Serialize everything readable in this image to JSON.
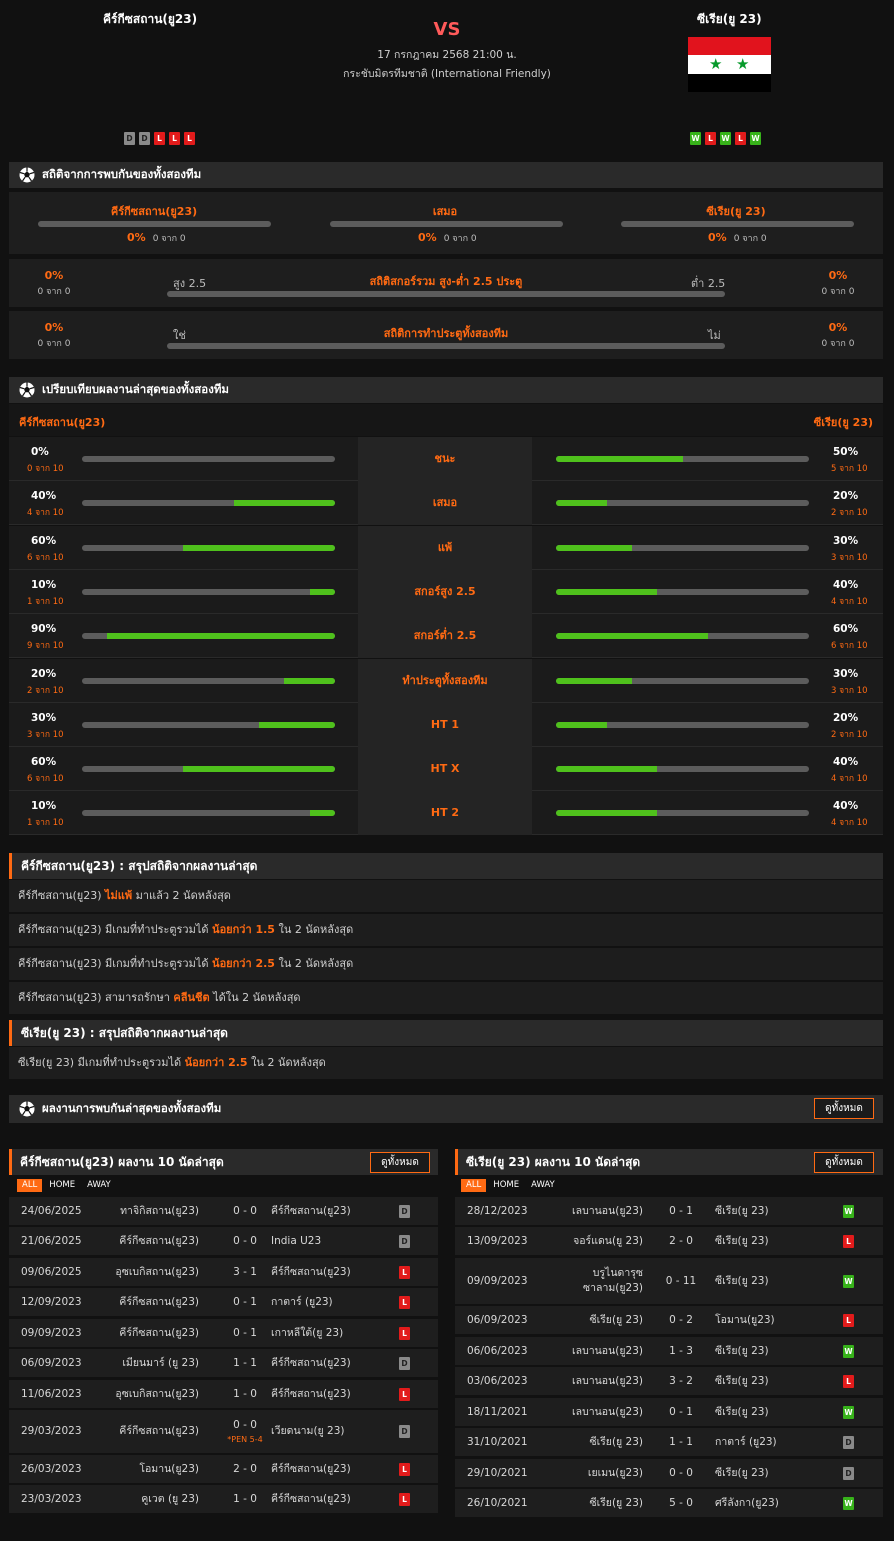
{
  "match": {
    "home": "คีร์กีซสถาน(ยู23)",
    "away": "ซีเรีย(ยู 23)",
    "vs": "VS",
    "date": "17 กรกฎาคม 2568 21:00 น.",
    "competition": "กระชับมิตรทีมชาติ (International Friendly)",
    "home_form": [
      "D",
      "D",
      "L",
      "L",
      "L"
    ],
    "away_form": [
      "W",
      "L",
      "W",
      "L",
      "W"
    ]
  },
  "h2h": {
    "title": "สถิติจากการพบกันของทั้งสองทีม",
    "home": "คีร์กีซสถาน(ยู23)",
    "draw": "เสมอ",
    "away": "ซีเรีย(ยู 23)",
    "home_pct": "0%",
    "draw_pct": "0%",
    "away_pct": "0%",
    "home_sub": "0 จาก 0",
    "draw_sub": "0 จาก 0",
    "away_sub": "0 จาก 0",
    "ou_title": "สถิติสกอร์รวม สูง-ต่ำ 2.5 ประตู",
    "over": "สูง 2.5",
    "under": "ต่ำ 2.5",
    "ou_left_pct": "0%",
    "ou_left_sub": "0 จาก 0",
    "ou_right_pct": "0%",
    "ou_right_sub": "0 จาก 0",
    "btts_title": "สถิติการทำประตูทั้งสองทีม",
    "yes": "ใช่",
    "no": "ไม่",
    "btts_left_pct": "0%",
    "btts_left_sub": "0 จาก 0",
    "btts_right_pct": "0%",
    "btts_right_sub": "0 จาก 0"
  },
  "compare": {
    "title": "เปรียบเทียบผลงานล่าสุดของทั้งสองทีม",
    "home": "คีร์กีซสถาน(ยู23)",
    "away": "ซีเรีย(ยู 23)",
    "rows": [
      {
        "label": "ชนะ",
        "hp": "0%",
        "hs": "0 จาก 10",
        "hv": 0,
        "ap": "50%",
        "as": "5 จาก 10",
        "av": 0.5
      },
      {
        "label": "เสมอ",
        "hp": "40%",
        "hs": "4 จาก 10",
        "hv": 0.4,
        "ap": "20%",
        "as": "2 จาก 10",
        "av": 0.2
      },
      {
        "label": "แพ้",
        "hp": "60%",
        "hs": "6 จาก 10",
        "hv": 0.6,
        "ap": "30%",
        "as": "3 จาก 10",
        "av": 0.3
      },
      {
        "label": "สกอร์สูง 2.5",
        "hp": "10%",
        "hs": "1 จาก 10",
        "hv": 0.1,
        "ap": "40%",
        "as": "4 จาก 10",
        "av": 0.4
      },
      {
        "label": "สกอร์ต่ำ 2.5",
        "hp": "90%",
        "hs": "9 จาก 10",
        "hv": 0.9,
        "ap": "60%",
        "as": "6 จาก 10",
        "av": 0.6
      },
      {
        "label": "ทำประตูทั้งสองทีม",
        "hp": "20%",
        "hs": "2 จาก 10",
        "hv": 0.2,
        "ap": "30%",
        "as": "3 จาก 10",
        "av": 0.3
      },
      {
        "label": "HT 1",
        "hp": "30%",
        "hs": "3 จาก 10",
        "hv": 0.3,
        "ap": "20%",
        "as": "2 จาก 10",
        "av": 0.2
      },
      {
        "label": "HT X",
        "hp": "60%",
        "hs": "6 จาก 10",
        "hv": 0.6,
        "ap": "40%",
        "as": "4 จาก 10",
        "av": 0.4
      },
      {
        "label": "HT 2",
        "hp": "10%",
        "hs": "1 จาก 10",
        "hv": 0.1,
        "ap": "40%",
        "as": "4 จาก 10",
        "av": 0.4
      }
    ]
  },
  "summary_home": {
    "title": "คีร์กีซสถาน(ยู23) : สรุปสถิติจากผลงานล่าสุด",
    "rows": [
      {
        "pre": "คีร์กีซสถาน(ยู23)",
        "hl": "ไม่แพ้",
        "post": "มาแล้ว 2 นัดหลังสุด"
      },
      {
        "pre": "คีร์กีซสถาน(ยู23) มีเกมที่ทำประตูรวมได้",
        "hl": "น้อยกว่า 1.5",
        "post": "ใน 2 นัดหลังสุด"
      },
      {
        "pre": "คีร์กีซสถาน(ยู23) มีเกมที่ทำประตูรวมได้",
        "hl": "น้อยกว่า 2.5",
        "post": "ใน 2 นัดหลังสุด"
      },
      {
        "pre": "คีร์กีซสถาน(ยู23) สามารถรักษา",
        "hl": "คลีนชีต",
        "post": "ได้ใน 2 นัดหลังสุด"
      }
    ]
  },
  "summary_away": {
    "title": "ซีเรีย(ยู 23) : สรุปสถิติจากผลงานล่าสุด",
    "rows": [
      {
        "pre": "ซีเรีย(ยู 23) มีเกมที่ทำประตูรวมได้",
        "hl": "น้อยกว่า 2.5",
        "post": "ใน 2 นัดหลังสุด"
      }
    ]
  },
  "h2h_results": {
    "title": "ผลงานการพบกันล่าสุดของทั้งสองทีม",
    "view_all": "ดูทั้งหมด"
  },
  "tabs": [
    "ALL",
    "HOME",
    "AWAY"
  ],
  "home_results": {
    "title": "คีร์กีซสถาน(ยู23) ผลงาน 10 นัดล่าสุด",
    "view_all": "ดูทั้งหมด",
    "rows": [
      {
        "date": "24/06/2025",
        "home": "ทาจิกิสถาน(ยู23)",
        "score": "0 - 0",
        "away": "คีร์กีซสถาน(ยู23)",
        "res": "D"
      },
      {
        "date": "21/06/2025",
        "home": "คีร์กีซสถาน(ยู23)",
        "score": "0 - 0",
        "away": "India U23",
        "res": "D"
      },
      {
        "date": "09/06/2025",
        "home": "อุซเบกิสถาน(ยู23)",
        "score": "3 - 1",
        "away": "คีร์กีซสถาน(ยู23)",
        "res": "L"
      },
      {
        "date": "12/09/2023",
        "home": "คีร์กีซสถาน(ยู23)",
        "score": "0 - 1",
        "away": "กาตาร์ (ยู23)",
        "res": "L"
      },
      {
        "date": "09/09/2023",
        "home": "คีร์กีซสถาน(ยู23)",
        "score": "0 - 1",
        "away": "เกาหลีใต้(ยู 23)",
        "res": "L"
      },
      {
        "date": "06/09/2023",
        "home": "เมียนมาร์ (ยู 23)",
        "score": "1 - 1",
        "away": "คีร์กีซสถาน(ยู23)",
        "res": "D"
      },
      {
        "date": "11/06/2023",
        "home": "อุซเบกิสถาน(ยู23)",
        "score": "1 - 0",
        "away": "คีร์กีซสถาน(ยู23)",
        "res": "L"
      },
      {
        "date": "29/03/2023",
        "home": "คีร์กีซสถาน(ยู23)",
        "score": "0 - 0",
        "pen": "*PEN 5-4",
        "away": "เวียดนาม(ยู 23)",
        "res": "D"
      },
      {
        "date": "26/03/2023",
        "home": "โอมาน(ยู23)",
        "score": "2 - 0",
        "away": "คีร์กีซสถาน(ยู23)",
        "res": "L"
      },
      {
        "date": "23/03/2023",
        "home": "คูเวต (ยู 23)",
        "score": "1 - 0",
        "away": "คีร์กีซสถาน(ยู23)",
        "res": "L"
      }
    ]
  },
  "away_results": {
    "title": "ซีเรีย(ยู 23) ผลงาน 10 นัดล่าสุด",
    "view_all": "ดูทั้งหมด",
    "rows": [
      {
        "date": "28/12/2023",
        "home": "เลบานอน(ยู23)",
        "score": "0 - 1",
        "away": "ซีเรีย(ยู 23)",
        "res": "W"
      },
      {
        "date": "13/09/2023",
        "home": "จอร์แดน(ยู 23)",
        "score": "2 - 0",
        "away": "ซีเรีย(ยู 23)",
        "res": "L"
      },
      {
        "date": "09/09/2023",
        "home": "บรูไนดารุซ",
        "home2": "ซาลาม(ยู23)",
        "score": "0 - 11",
        "away": "ซีเรีย(ยู 23)",
        "res": "W"
      },
      {
        "date": "06/09/2023",
        "home": "ซีเรีย(ยู 23)",
        "score": "0 - 2",
        "away": "โอมาน(ยู23)",
        "res": "L"
      },
      {
        "date": "06/06/2023",
        "home": "เลบานอน(ยู23)",
        "score": "1 - 3",
        "away": "ซีเรีย(ยู 23)",
        "res": "W"
      },
      {
        "date": "03/06/2023",
        "home": "เลบานอน(ยู23)",
        "score": "3 - 2",
        "away": "ซีเรีย(ยู 23)",
        "res": "L"
      },
      {
        "date": "18/11/2021",
        "home": "เลบานอน(ยู23)",
        "score": "0 - 1",
        "away": "ซีเรีย(ยู 23)",
        "res": "W"
      },
      {
        "date": "31/10/2021",
        "home": "ซีเรีย(ยู 23)",
        "score": "1 - 1",
        "away": "กาตาร์ (ยู23)",
        "res": "D"
      },
      {
        "date": "29/10/2021",
        "home": "เยเมน(ยู23)",
        "score": "0 - 0",
        "away": "ซีเรีย(ยู 23)",
        "res": "D"
      },
      {
        "date": "26/10/2021",
        "home": "ซีเรีย(ยู 23)",
        "score": "5 - 0",
        "away": "ศรีลังกา(ยู23)",
        "res": "W"
      }
    ]
  },
  "colors": {
    "accent": "#ff6a13",
    "win": "#37b21a",
    "loss": "#e21b1b",
    "draw": "#8a8a8a",
    "bar_fill": "#4fc11c"
  }
}
